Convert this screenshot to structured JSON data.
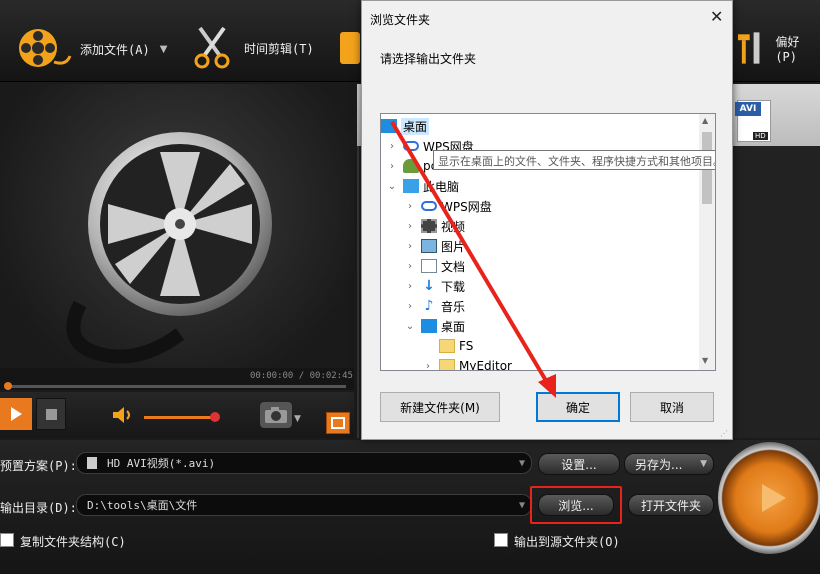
{
  "toolbar": {
    "add_file": "添加文件(A)",
    "time_clip": "时间剪辑(T)",
    "preferences": "偏好(P)"
  },
  "player": {
    "time_current": "00:00:00",
    "time_sep": "/",
    "time_total": "00:02:45"
  },
  "list": {
    "file_badge": "AVI",
    "file_badge_sub": "HD"
  },
  "bottom": {
    "preset_label": "预置方案(P):",
    "preset_value": "HD AVI视频(*.avi)",
    "settings_btn": "设置...",
    "save_as_btn": "另存为...",
    "output_label": "输出目录(D):",
    "output_value": "D:\\tools\\桌面\\文件",
    "browse_btn": "浏览...",
    "open_folder_btn": "打开文件夹",
    "copy_structure_label": "复制文件夹结构(C)",
    "output_to_source_label": "输出到源文件夹(O)"
  },
  "dialog": {
    "title": "浏览文件夹",
    "prompt": "请选择输出文件夹",
    "tooltip": "显示在桌面上的文件、文件夹、程序快捷方式和其他项目。",
    "tree": [
      {
        "label": "桌面"
      },
      {
        "label": "WPS网盘"
      },
      {
        "label": "pc"
      },
      {
        "label": "此电脑"
      },
      {
        "label": "WPS网盘"
      },
      {
        "label": "视频"
      },
      {
        "label": "图片"
      },
      {
        "label": "文档"
      },
      {
        "label": "下载"
      },
      {
        "label": "音乐"
      },
      {
        "label": "桌面"
      },
      {
        "label": "FS"
      },
      {
        "label": "MyEditor"
      }
    ],
    "new_folder_btn": "新建文件夹(M)",
    "ok_btn": "确定",
    "cancel_btn": "取消"
  },
  "colors": {
    "accent_orange": "#e8791f",
    "annotation_red": "#e8231c",
    "selection_blue": "#cce8ff"
  }
}
